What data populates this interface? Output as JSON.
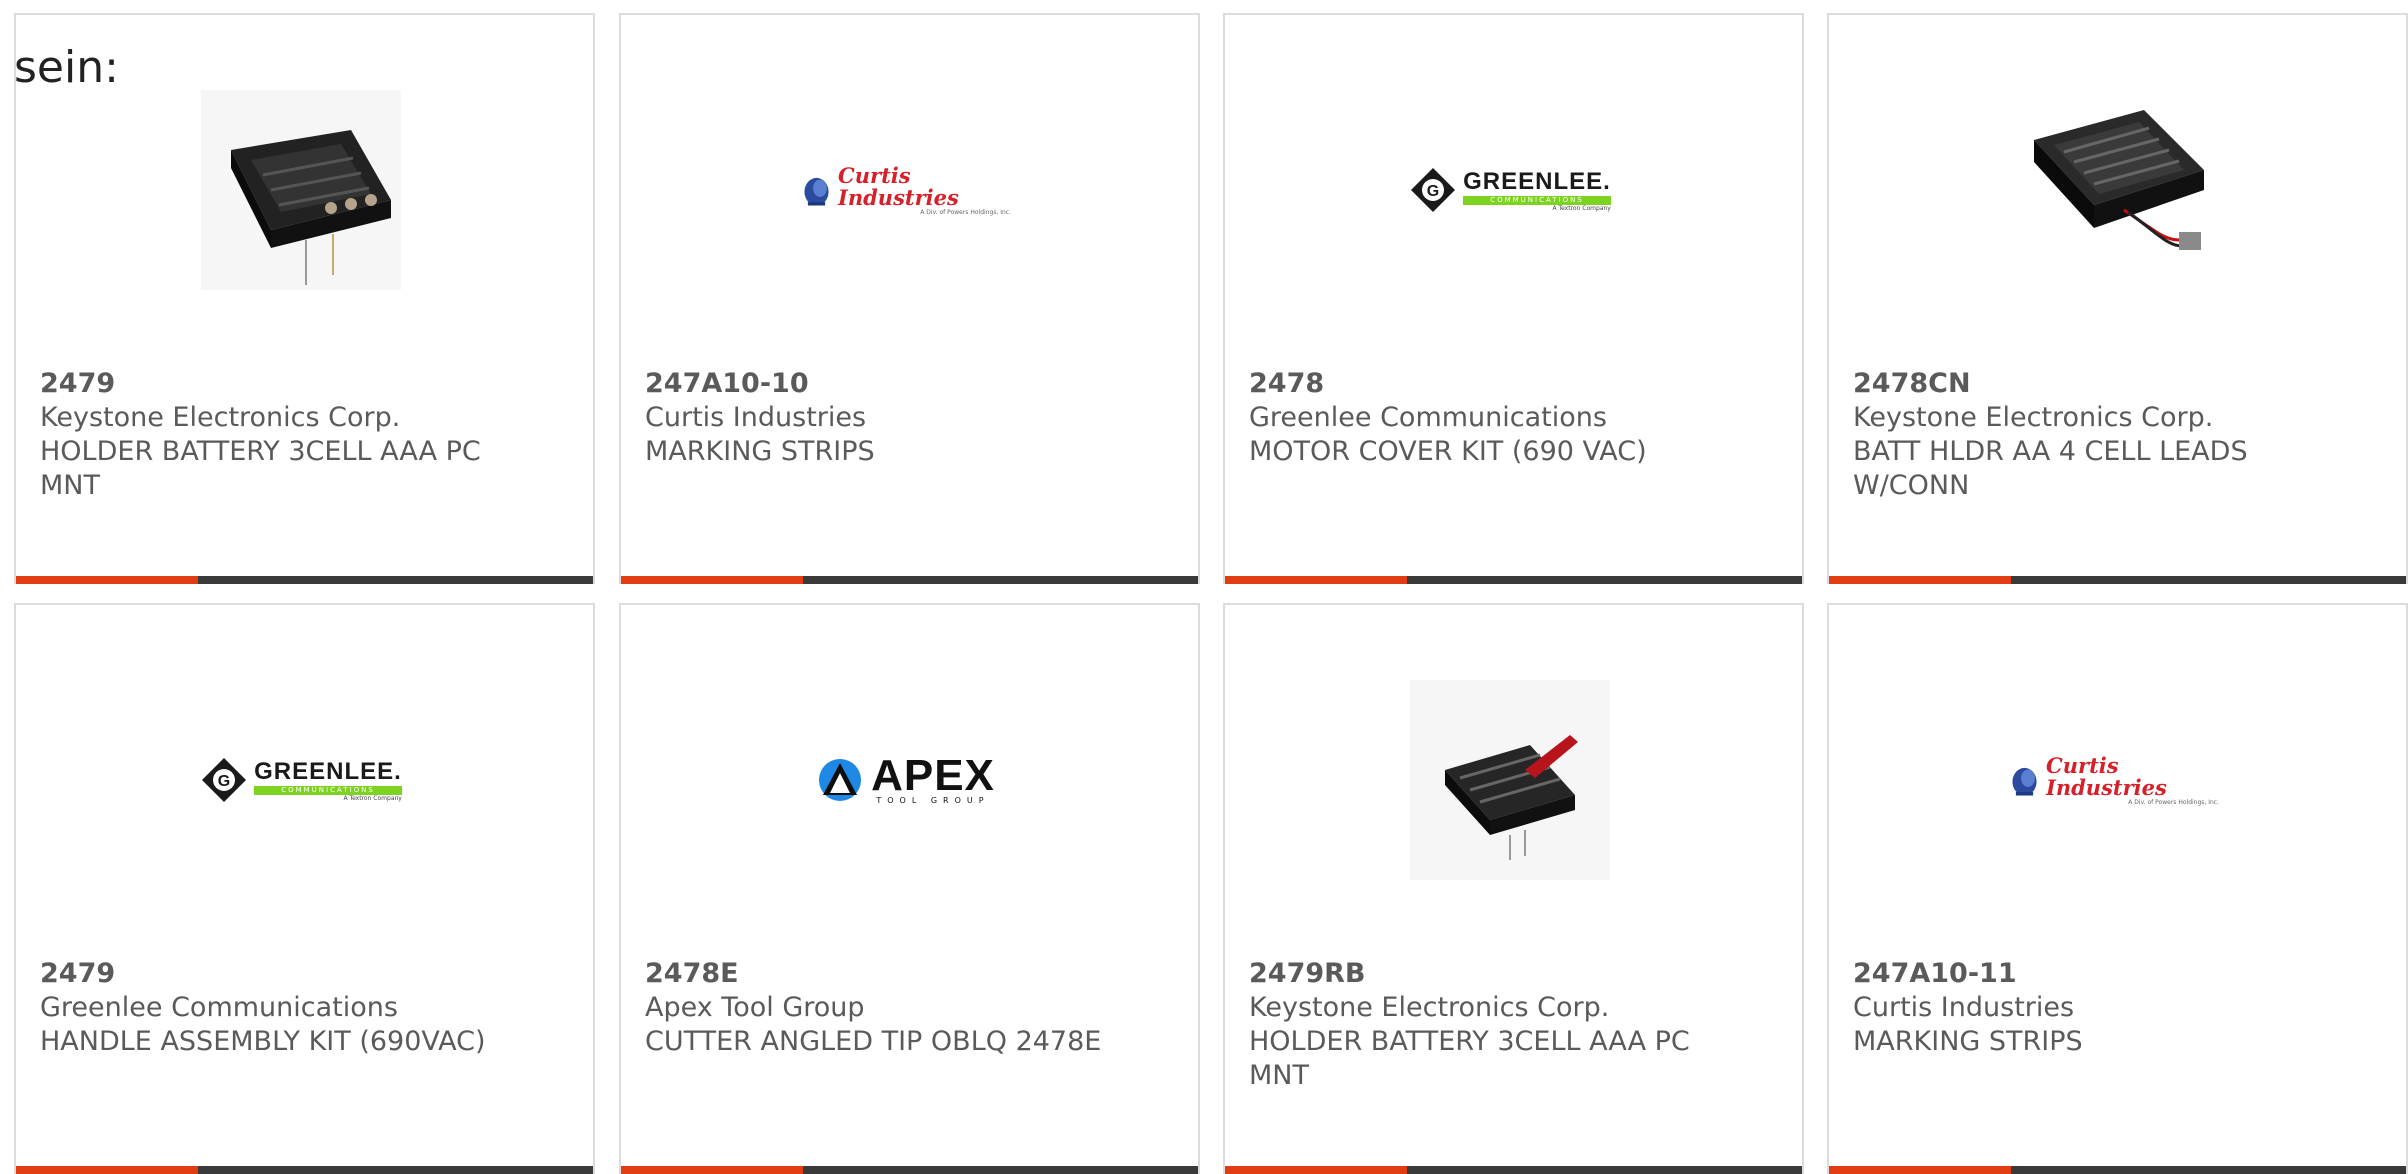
{
  "heading_fragment": "sein:",
  "products": [
    {
      "part": "2479",
      "manufacturer": "Keystone Electronics Corp.",
      "description": "HOLDER BATTERY 3CELL AAA PC MNT",
      "image": "battery-holder-3cell-image"
    },
    {
      "part": "247A10-10",
      "manufacturer": "Curtis Industries",
      "description": "MARKING STRIPS",
      "image": "curtis-industries-logo",
      "logo_text": "Curtis Industries",
      "logo_sub": "A Div. of Powers Holdings, Inc."
    },
    {
      "part": "2478",
      "manufacturer": "Greenlee Communications",
      "description": "MOTOR COVER KIT (690 VAC)",
      "image": "greenlee-logo",
      "logo_text": "GREENLEE.",
      "logo_strip": "COMMUNICATIONS",
      "logo_sub": "A Textron Company"
    },
    {
      "part": "2478CN",
      "manufacturer": "Keystone Electronics Corp.",
      "description": "BATT HLDR AA 4 CELL LEADS W/CONN",
      "image": "battery-holder-4cell-image"
    },
    {
      "part": "2479",
      "manufacturer": "Greenlee Communications",
      "description": "HANDLE ASSEMBLY KIT (690VAC)",
      "image": "greenlee-logo",
      "logo_text": "GREENLEE.",
      "logo_strip": "COMMUNICATIONS",
      "logo_sub": "A Textron Company"
    },
    {
      "part": "2478E",
      "manufacturer": "Apex Tool Group",
      "description": "CUTTER ANGLED TIP OBLQ 2478E",
      "image": "apex-tool-group-logo",
      "logo_text": "APEX",
      "logo_sub": "TOOL GROUP"
    },
    {
      "part": "2479RB",
      "manufacturer": "Keystone Electronics Corp.",
      "description": "HOLDER BATTERY 3CELL AAA PC MNT",
      "image": "battery-holder-3cell-leads-image"
    },
    {
      "part": "247A10-11",
      "manufacturer": "Curtis Industries",
      "description": "MARKING STRIPS",
      "image": "curtis-industries-logo",
      "logo_text": "Curtis Industries",
      "logo_sub": "A Div. of Powers Holdings, Inc."
    }
  ],
  "colors": {
    "accent": "#e13c12",
    "bar": "#3a3a3a",
    "text": "#5a5a5a",
    "border": "#dcdcdc"
  }
}
